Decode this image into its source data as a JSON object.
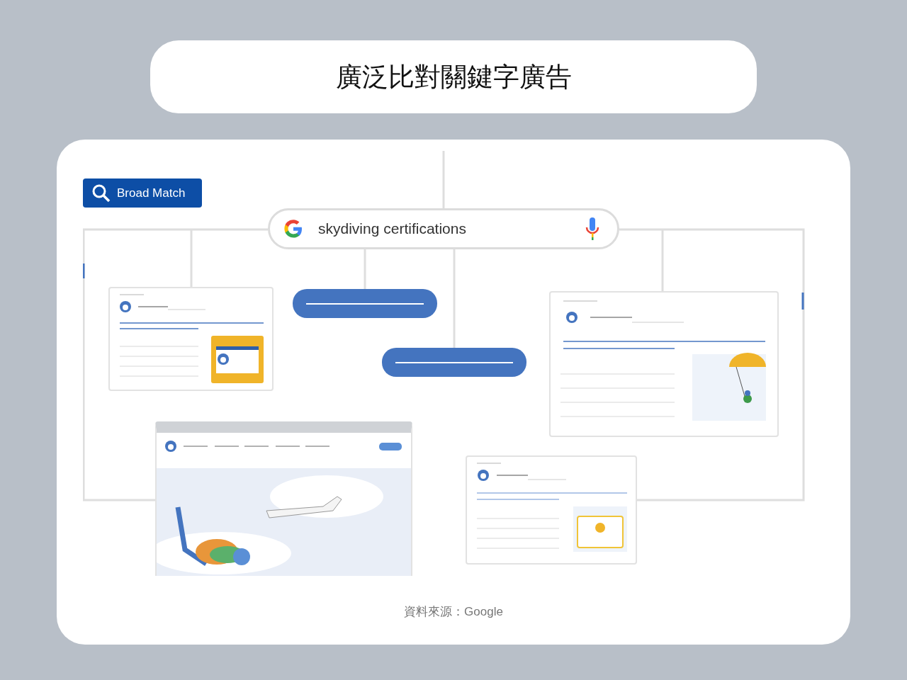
{
  "title": "廣泛比對關鍵字廣告",
  "badge": {
    "label": "Broad Match"
  },
  "search": {
    "query": "skydiving certifications"
  },
  "source": "資料來源：Google"
}
